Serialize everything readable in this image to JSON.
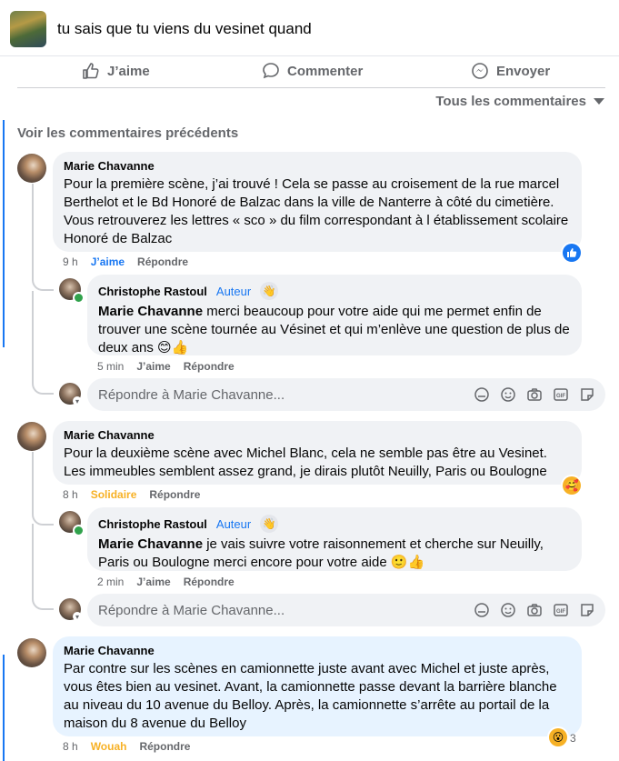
{
  "header": {
    "title": "tu sais que tu viens du vesinet quand"
  },
  "actions": {
    "like": "J’aime",
    "comment": "Commenter",
    "share": "Envoyer"
  },
  "sort": {
    "label": "Tous les commentaires"
  },
  "see_previous": "Voir les commentaires précédents",
  "comments": [
    {
      "author": "Marie Chavanne",
      "text": "Pour la première scène, j’ai trouvé ! Cela se passe au croisement de la rue marcel Berthelot et le Bd Honoré de Balzac dans la ville de Nanterre à côté du cimetière. Vous retrouverez les lettres « sco » du film correspondant à l établissement scolaire Honoré de Balzac",
      "time": "9 h",
      "reaction_label": "J’aime",
      "reply_label": "Répondre",
      "reaction_icon": "like-reaction-icon",
      "replies": [
        {
          "author": "Christophe Rastoul",
          "badge": "Auteur",
          "mention": "Marie Chavanne",
          "text": " merci beaucoup pour votre aide qui me permet enfin de trouver une scène tournée au Vésinet et qui m’enlève une question de plus de deux ans 😊👍",
          "time": "5 min",
          "reaction_label": "J’aime",
          "reply_label": "Répondre"
        }
      ],
      "reply_placeholder": "Répondre à Marie Chavanne..."
    },
    {
      "author": "Marie Chavanne",
      "text": "Pour la deuxième scène avec Michel Blanc, cela ne semble pas être au Vesinet. Les immeubles semblent assez grand, je dirais plutôt Neuilly, Paris ou Boulogne",
      "time": "8 h",
      "reaction_label": "Solidaire",
      "reply_label": "Répondre",
      "reaction_icon": "care-reaction-icon",
      "replies": [
        {
          "author": "Christophe Rastoul",
          "badge": "Auteur",
          "mention": "Marie Chavanne",
          "text": " je vais suivre votre raisonnement et cherche sur Neuilly, Paris ou Boulogne merci encore pour votre aide 🙂👍",
          "time": "2 min",
          "reaction_label": "J’aime",
          "reply_label": "Répondre"
        }
      ],
      "reply_placeholder": "Répondre à Marie Chavanne..."
    },
    {
      "author": "Marie Chavanne",
      "text": "Par contre sur les scènes en camionnette juste avant avec Michel et juste après, vous êtes bien au vesinet. Avant, la camionnette passe devant la barrière blanche au niveau du 10 avenue du Belloy. Après, la camionnette s’arrête au portail de la maison du 8 avenue du Belloy",
      "time": "8 h",
      "reaction_label": "Wouah",
      "reply_label": "Répondre",
      "reaction_icon": "wow-reaction-icon",
      "reaction_count": "3"
    }
  ],
  "colors": {
    "accent": "#1877f2",
    "bubble": "#f0f2f5",
    "bubble_highlight": "#e7f3ff",
    "care": "#f7b125"
  }
}
